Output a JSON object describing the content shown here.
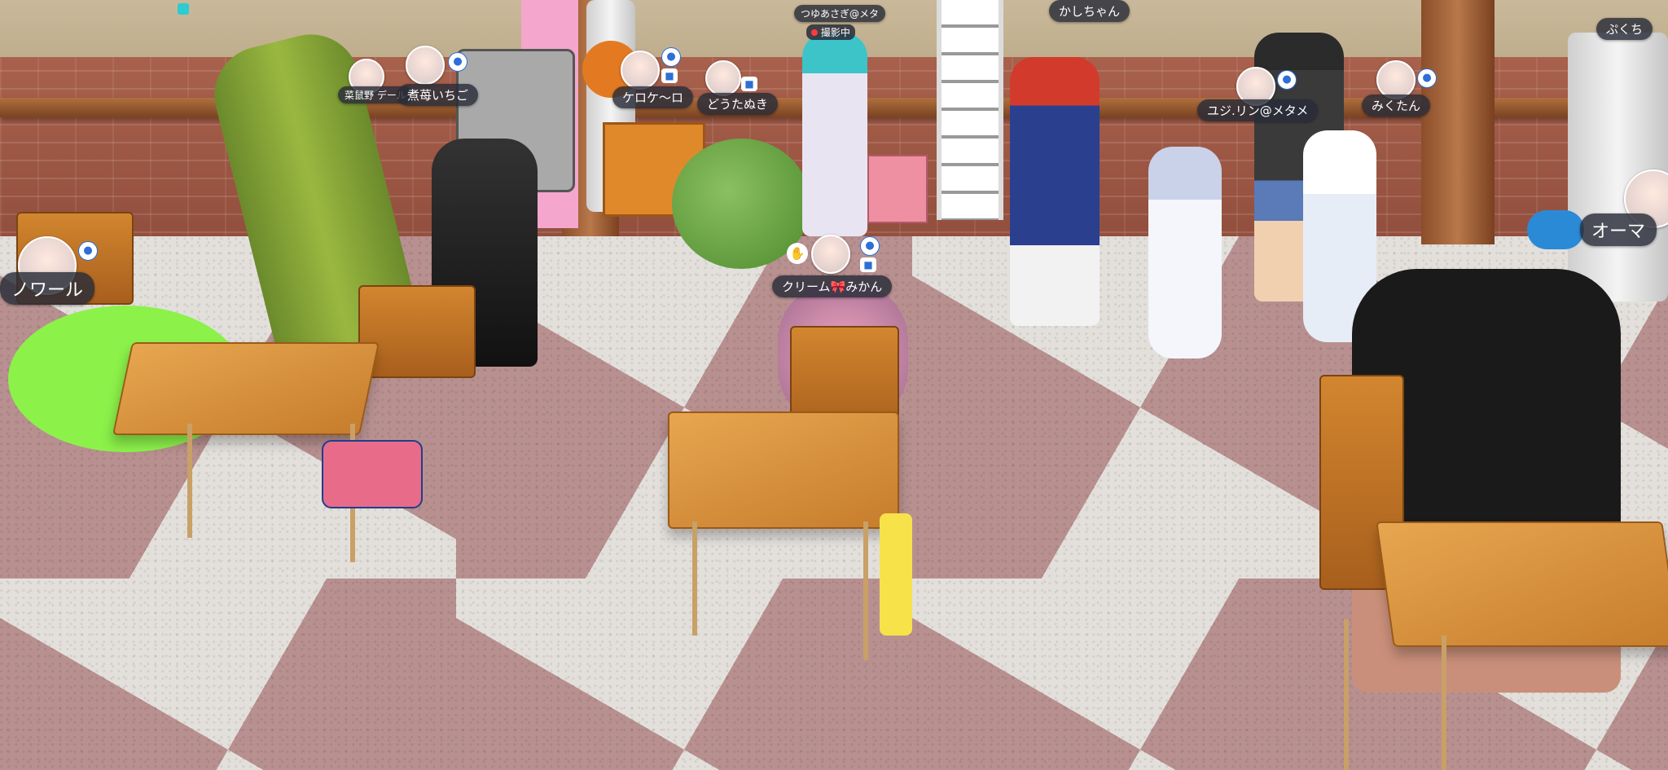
{
  "players": [
    {
      "id": "kakuji",
      "name": "菜鼠野 デール"
    },
    {
      "id": "ichigo",
      "name": "煮苺いちご"
    },
    {
      "id": "noir",
      "name": "ノワール"
    },
    {
      "id": "kerokero",
      "name": "ケロケ〜ロ"
    },
    {
      "id": "doutanuki",
      "name": "どうたぬき"
    },
    {
      "id": "tsuyu",
      "name": "つゆあさぎ@メタ",
      "status": "撮影中"
    },
    {
      "id": "cream",
      "name": "クリーム🎀みかん"
    },
    {
      "id": "kashi",
      "name": "かしちゃん"
    },
    {
      "id": "yuji",
      "name": "ユジ.リン@メタメ"
    },
    {
      "id": "mikutan",
      "name": "みくたん"
    },
    {
      "id": "puku",
      "name": "ぷくち"
    },
    {
      "id": "omachi",
      "name": "オーマ"
    }
  ],
  "icons": {
    "mic": "mic-icon",
    "camera": "camera-icon",
    "gesture": "hand-wave-icon"
  },
  "colors": {
    "nameplate_bg": "#282c38",
    "status_dot": "#ff3b3b",
    "badge_blue": "#2d6fd6"
  }
}
